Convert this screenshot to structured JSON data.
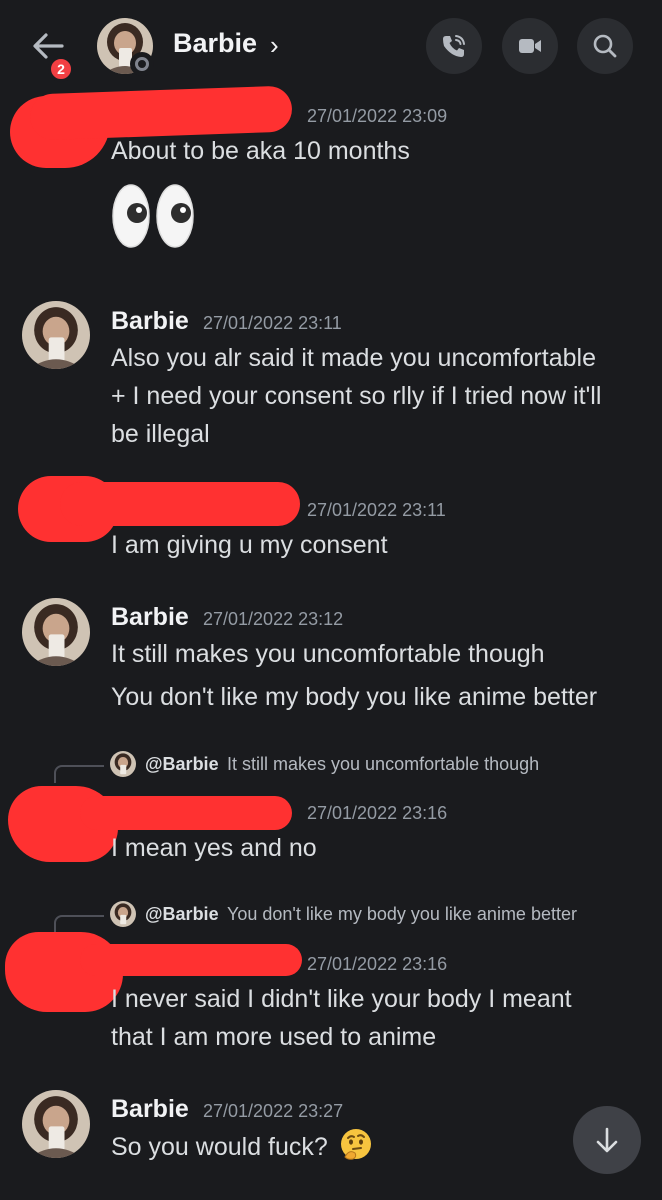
{
  "header": {
    "unread_count": "2",
    "contact_name": "Barbie",
    "chevron": "›",
    "icons": [
      "back-arrow-icon",
      "phone-call-icon",
      "video-camera-icon",
      "search-icon"
    ]
  },
  "messages": [
    {
      "author": "",
      "redacted": true,
      "time": "27/01/2022 23:09",
      "lines": [
        "About to be aka 10 months"
      ],
      "emoji": "eyes-emoji"
    },
    {
      "author": "Barbie",
      "time": "27/01/2022 23:11",
      "lines": [
        "Also you alr said it made you uncomfortable",
        "+ I need your consent so rlly if I tried now it'll",
        "be illegal"
      ]
    },
    {
      "author": "",
      "redacted": true,
      "time": "27/01/2022 23:11",
      "lines": [
        "I am giving u my consent"
      ]
    },
    {
      "author": "Barbie",
      "time": "27/01/2022 23:12",
      "lines": [
        "It still makes you uncomfortable though",
        "You don't like my body you like anime better"
      ]
    },
    {
      "author": "",
      "redacted": true,
      "time": "27/01/2022 23:16",
      "reply": {
        "to": "@Barbie",
        "text": "It still makes you uncomfortable though"
      },
      "lines": [
        "I mean yes and no"
      ]
    },
    {
      "author": "",
      "redacted": true,
      "time": "27/01/2022 23:16",
      "reply": {
        "to": "@Barbie",
        "text": "You don't like my body you like anime better"
      },
      "lines": [
        "I never said I didn't like your body I meant",
        "that I am more used to anime"
      ]
    },
    {
      "author": "Barbie",
      "time": "27/01/2022 23:27",
      "lines": [
        "So you would fuck?"
      ],
      "emoji": "thinking-face-emoji"
    }
  ],
  "colors": {
    "background": "#1a1b1e",
    "redaction": "#ff3131",
    "badge": "#f23f43",
    "button": "#2b2d31"
  }
}
